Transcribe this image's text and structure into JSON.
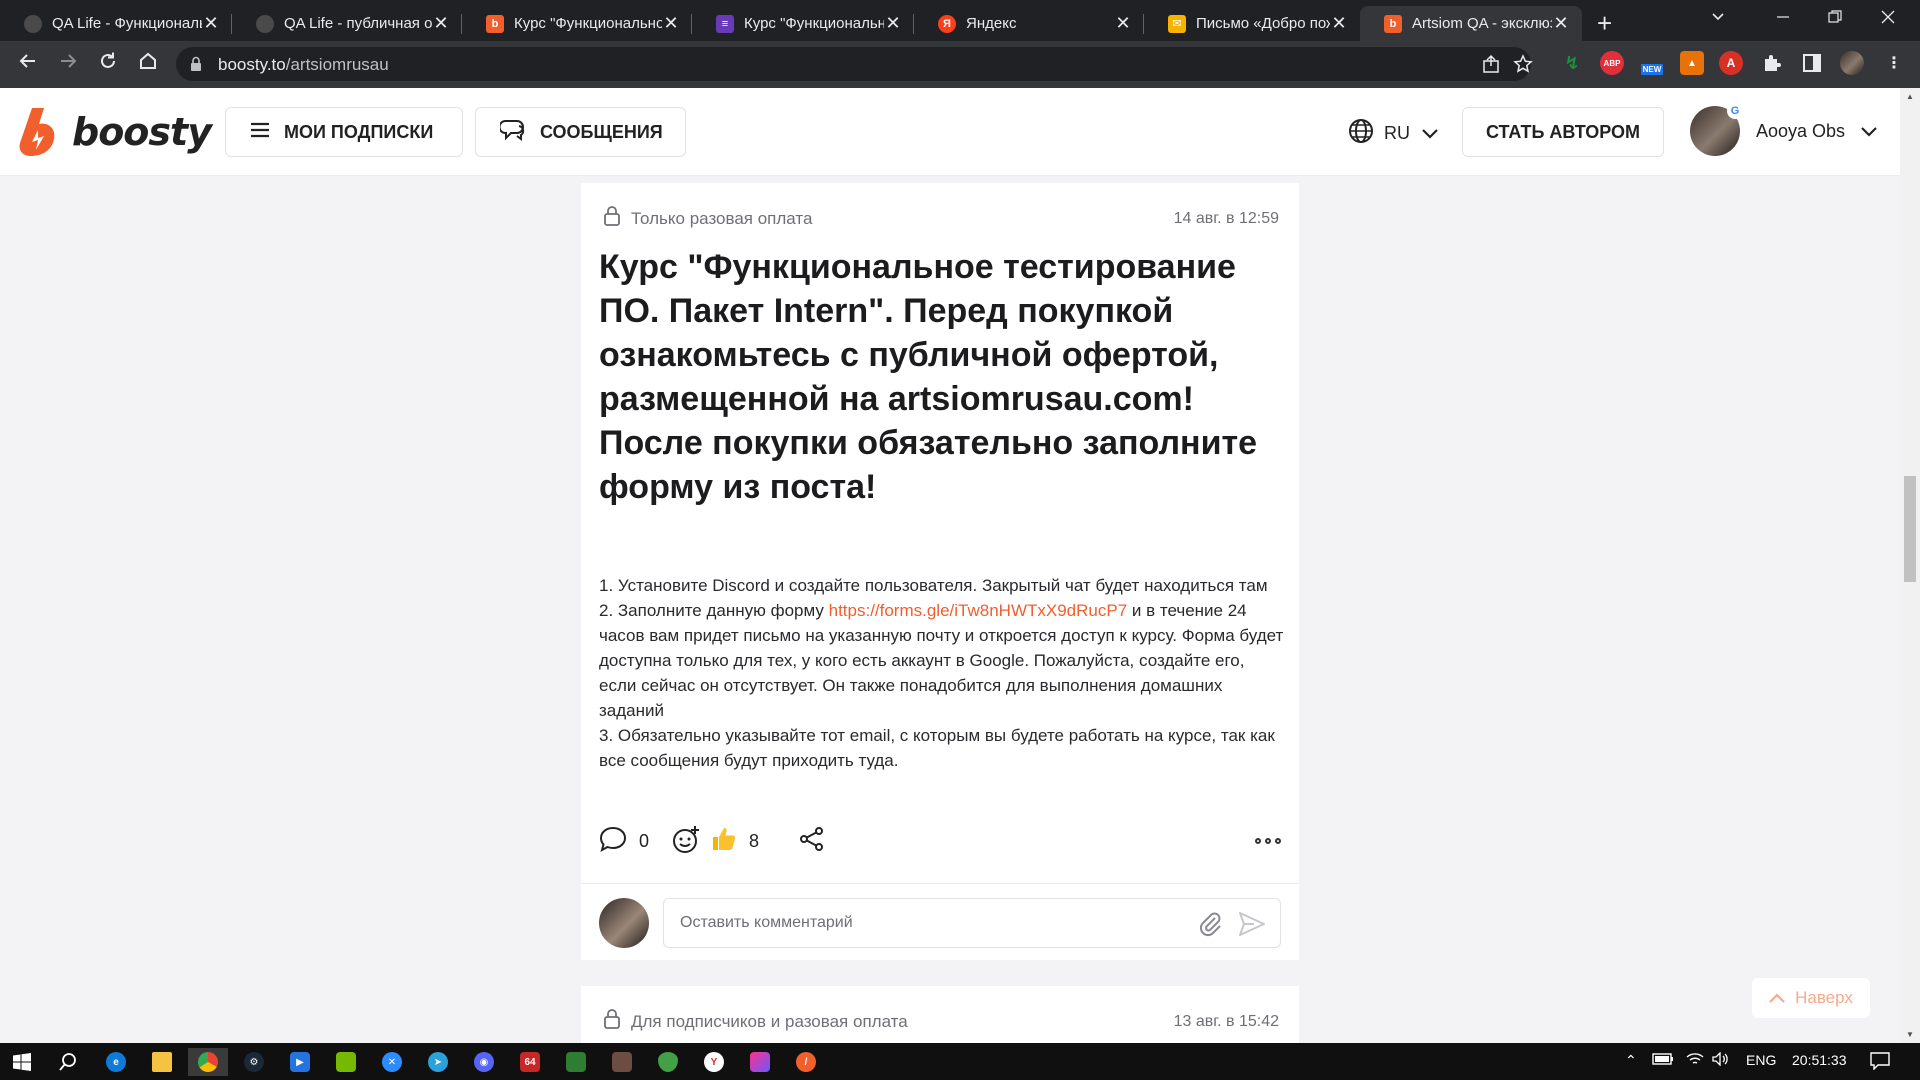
{
  "browser": {
    "tabs": [
      {
        "title": "QA Life - Функциональное тестирование",
        "favicon_color": "#4a4a4a",
        "favicon_text": "",
        "active": false
      },
      {
        "title": "QA Life - публичная оферта",
        "favicon_color": "#4a4a4a",
        "favicon_text": "",
        "active": false
      },
      {
        "title": "Курс \"Функциональное тестирование\"",
        "favicon_color": "#f15f2c",
        "favicon_text": "b",
        "active": false
      },
      {
        "title": "Курс \"Функциональное тестирование\"",
        "favicon_color": "#673ab7",
        "favicon_text": "≡",
        "active": false
      },
      {
        "title": "Яндекс",
        "favicon_color": "#fc3f1d",
        "favicon_text": "Я",
        "active": false
      },
      {
        "title": "Письмо «Добро пожаловать»",
        "favicon_color": "#f6b400",
        "favicon_text": "✉",
        "active": false
      },
      {
        "title": "Artsiom QA - эксклюзивный контент",
        "favicon_color": "#f15f2c",
        "favicon_text": "b",
        "active": true
      }
    ],
    "url_host": "boosty.to",
    "url_path": "/artsiomrusau",
    "extensions": [
      {
        "name": "green-extension-icon",
        "color": "#1e8e3e",
        "text": "↯"
      },
      {
        "name": "adblock-plus-icon",
        "color": "#e0303a",
        "text": "ABP"
      },
      {
        "name": "new-extension-icon",
        "color": "#4a4a4a",
        "text": "NEW"
      },
      {
        "name": "orange-extension-icon",
        "color": "#e8710a",
        "text": "▲"
      },
      {
        "name": "red-a-extension-icon",
        "color": "#d93025",
        "text": "A"
      }
    ]
  },
  "header": {
    "logo_text": "boosty",
    "subscriptions_label": "МОИ ПОДПИСКИ",
    "messages_label": "СООБЩЕНИЯ",
    "language": "RU",
    "become_author_label": "СТАТЬ АВТОРОМ",
    "user_name": "Aooya Obs"
  },
  "post": {
    "access": "Только разовая оплата",
    "date": "14 авг. в 12:59",
    "title": "Курс \"Функциональное тестирование ПО. Пакет Intern\". Перед покупкой ознакомьтесь с публичной офертой, размещенной на artsiomrusau.com! После покупки обязательно заполните форму из поста!",
    "step1": "1. Установите Discord и создайте пользователя. Закрытый чат будет находиться там",
    "step2_before": "2. Заполните данную форму ",
    "step2_link": "https://forms.gle/iTw8nHWTxX9dRucP7",
    "step2_after": " и в течение 24 часов вам придет письмо на указанную почту и откроется доступ к курсу. Форма будет доступна только для тех, у кого есть аккаунт в Google. Пожалуйста, создайте его, если сейчас он отсутствует. Он также понадобится для выполнения домашних заданий",
    "step3": "3. Обязательно указывайте тот email, с которым вы будете работать на курсе, так как все сообщения будут приходить туда.",
    "comments_count": "0",
    "likes_count": "8",
    "comment_placeholder": "Оставить комментарий"
  },
  "next_post": {
    "access": "Для подписчиков и разовая оплата",
    "date": "13 авг. в 15:42"
  },
  "scroll_top_label": "Наверх",
  "taskbar": {
    "language": "ENG",
    "time": "20:51:33"
  }
}
